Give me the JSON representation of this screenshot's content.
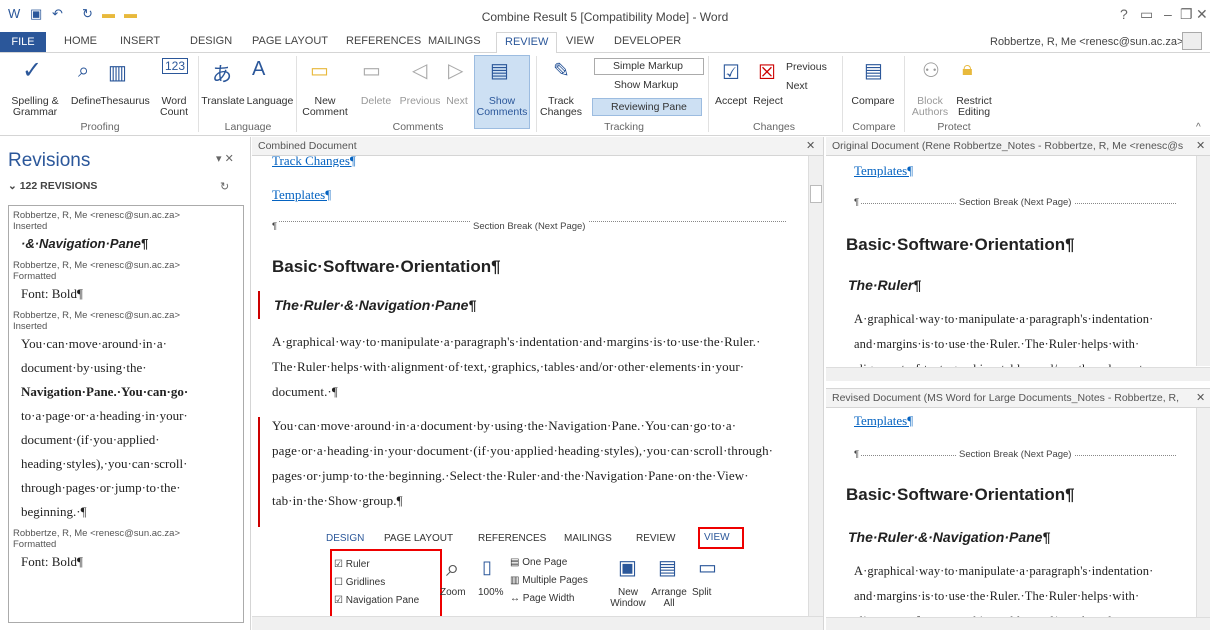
{
  "title": "Combine Result 5 [Compatibility Mode] - Word",
  "user": "Robbertze, R, Me <renesc@sun.ac.za>",
  "tabs": [
    "FILE",
    "HOME",
    "INSERT",
    "DESIGN",
    "PAGE LAYOUT",
    "REFERENCES",
    "MAILINGS",
    "REVIEW",
    "VIEW",
    "DEVELOPER"
  ],
  "ribbon": {
    "spelling": "Spelling & Grammar",
    "define": "Define",
    "thesaurus": "Thesaurus",
    "wordcount": "Word Count",
    "translate": "Translate",
    "language": "Language",
    "newcomment": "New Comment",
    "delete": "Delete",
    "previous": "Previous",
    "next": "Next",
    "showcomments": "Show Comments",
    "trackchanges": "Track Changes",
    "markup": "Simple Markup",
    "showmarkup": "Show Markup",
    "reviewingpane": "Reviewing Pane",
    "accept": "Accept",
    "reject": "Reject",
    "prevchange": "Previous",
    "nextchange": "Next",
    "compare": "Compare",
    "blockauthors": "Block Authors",
    "restrict": "Restrict Editing",
    "groups": [
      "Proofing",
      "Language",
      "Comments",
      "Tracking",
      "Changes",
      "Compare",
      "Protect"
    ]
  },
  "revisions": {
    "title": "Revisions",
    "count": "122 REVISIONS",
    "items": [
      {
        "author": "Robbertze, R, Me <renesc@sun.ac.za>",
        "action": "Inserted",
        "text": "·&·Navigation·Pane¶"
      },
      {
        "author": "Robbertze, R, Me <renesc@sun.ac.za>",
        "action": "Formatted",
        "text": "Font: Bold¶"
      },
      {
        "author": "Robbertze, R, Me <renesc@sun.ac.za>",
        "action": "Inserted",
        "lines": [
          "You·can·move·around·in·a·",
          "document·by·using·the·",
          "Navigation·Pane.·You·can·go·",
          "to·a·page·or·a·heading·in·your·",
          "document·(if·you·applied·",
          "heading·styles),·you·can·scroll·",
          "through·pages·or·jump·to·the·",
          "beginning.·¶"
        ]
      },
      {
        "author": "Robbertze, R, Me <renesc@sun.ac.za>",
        "action": "Formatted",
        "text": "Font: Bold¶"
      }
    ]
  },
  "combined": {
    "header": "Combined Document",
    "trackchanges": "Track Changes¶",
    "templates": "Templates¶",
    "sectionbreak": "Section Break (Next Page)",
    "h1": "Basic·Software·Orientation¶",
    "h2": "The·Ruler·&·Navigation·Pane¶",
    "p1": [
      "A·graphical·way·to·manipulate·a·paragraph's·indentation·and·margins·is·to·use·the·Ruler.·",
      "The·Ruler·helps·with·alignment·of·text,·graphics,·tables·and/or·other·elements·in·your·",
      "document.·¶"
    ],
    "p2": [
      "You·can·move·around·in·a·document·by·using·the·Navigation·Pane.·You·can·go·to·a·",
      "page·or·a·heading·in·your·document·(if·you·applied·heading·styles),·you·can·scroll·through·",
      "pages·or·jump·to·the·beginning.·Select·the·Ruler·and·the·Navigation·Pane·on·the·View·",
      "tab·in·the·Show·group.¶"
    ],
    "embed": {
      "tabs": [
        "DESIGN",
        "PAGE LAYOUT",
        "REFERENCES",
        "MAILINGS",
        "REVIEW",
        "VIEW"
      ],
      "checks": [
        "Ruler",
        "Gridlines",
        "Navigation Pane"
      ],
      "zoom": "Zoom",
      "pct": "100%",
      "onepage": "One Page",
      "multi": "Multiple Pages",
      "pagewidth": "Page Width",
      "newwin": "New Window",
      "arrange": "Arrange All",
      "split": "Split"
    }
  },
  "original": {
    "header": "Original Document (Rene Robbertze_Notes - Robbertze, R, Me <renesc@s",
    "templates": "Templates¶",
    "sectionbreak": "Section Break (Next Page)",
    "h1": "Basic·Software·Orientation¶",
    "h2": "The·Ruler¶",
    "lines": [
      "A·graphical·way·to·manipulate·a·paragraph's·indentation·",
      "and·margins·is·to·use·the·Ruler.·The·Ruler·helps·with·",
      "alignment·of·text,·graphics,·tables·and/or·other·elements"
    ]
  },
  "revised": {
    "header": "Revised Document (MS Word for Large Documents_Notes - Robbertze, R,",
    "templates": "Templates¶",
    "sectionbreak": "Section Break (Next Page)",
    "h1": "Basic·Software·Orientation¶",
    "h2": "The·Ruler·&·Navigation·Pane¶",
    "lines": [
      "A·graphical·way·to·manipulate·a·paragraph's·indentation·",
      "and·margins·is·to·use·the·Ruler.·The·Ruler·helps·with·",
      "alignment·of·text,·graphics,·tables·and/or·other·elements"
    ]
  }
}
